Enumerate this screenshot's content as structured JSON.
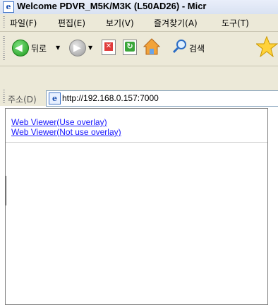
{
  "window": {
    "title": "Welcome PDVR_M5K/M3K (L50AD26) - Micr",
    "title_icon": "ie-icon"
  },
  "menu": {
    "items": [
      "파일(F)",
      "편집(E)",
      "보기(V)",
      "즐겨찾기(A)",
      "도구(T)"
    ]
  },
  "toolbar": {
    "back_label": "뒤로",
    "search_label": "검색"
  },
  "address": {
    "label": "주소(D)",
    "url": "http://192.168.0.157:7000"
  },
  "content": {
    "links": [
      "Web Viewer(Use overlay)",
      "Web Viewer(Not use overlay)"
    ]
  }
}
